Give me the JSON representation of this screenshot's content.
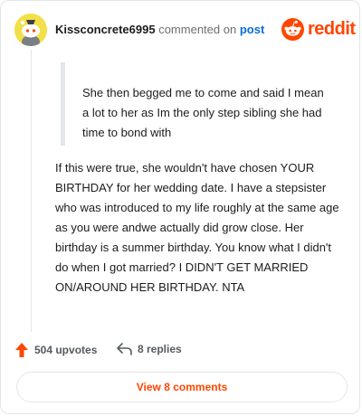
{
  "header": {
    "username": "Kissconcrete6995",
    "action_text": "commented on",
    "post_link": "post"
  },
  "brand": {
    "name": "reddit",
    "icon": "reddit-logo-icon",
    "color": "#ff4500"
  },
  "quote": {
    "text": "She then begged me to come and said I mean a lot to her as Im the only step sibling she had time to bond with"
  },
  "comment": {
    "body": "If this were true, she wouldn't have chosen YOUR BIRTHDAY for her wedding date. I have a stepsister who was introduced to my life roughly at the same age as you were andwe actually did grow close. Her birthday is a summer birthday. You know what I didn't do when I got married? I DIDN'T GET MARRIED ON/AROUND HER BIRTHDAY. NTA"
  },
  "footer": {
    "upvotes": "504 upvotes",
    "upvote_icon": "upvote-arrow-icon",
    "replies": "8 replies",
    "reply_icon": "reply-arrow-icon",
    "view_comments": "View 8 comments"
  },
  "colors": {
    "accent": "#ff4500",
    "link": "#0a6bd6",
    "avatar_bg": "#f2e04a"
  }
}
